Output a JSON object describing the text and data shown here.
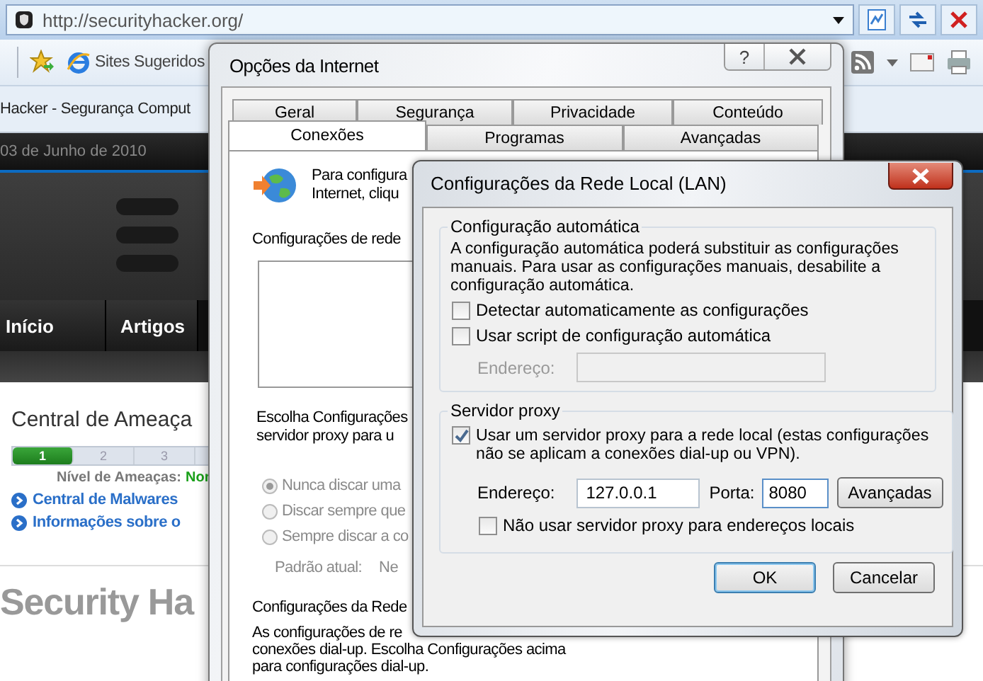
{
  "browser": {
    "address": "http://securityhacker.org/",
    "favorites": [
      {
        "label": "Sites Sugeridos"
      }
    ],
    "tab_title": "Hacker - Segurança Comput",
    "site": {
      "date": "03 de Junho de 2010",
      "nav": [
        {
          "label": "Início"
        },
        {
          "label": "Artigos"
        }
      ],
      "threat_center": {
        "title": "Central de Ameaça",
        "levels": [
          {
            "label": "1",
            "selected": true
          },
          {
            "label": "2",
            "selected": false
          },
          {
            "label": "3",
            "selected": false
          }
        ],
        "level_label": "Nível de Ameaças:",
        "level_value": "Nor"
      },
      "links": [
        "Central de Malwares",
        "Informações sobre o"
      ],
      "heading": "Security Ha"
    }
  },
  "internet_options": {
    "title": "Opções da Internet",
    "help": "?",
    "tab_rows": [
      [
        {
          "label": "Geral",
          "selected": false
        },
        {
          "label": "Segurança",
          "selected": false
        },
        {
          "label": "Privacidade",
          "selected": false
        },
        {
          "label": "Conteúdo",
          "selected": false
        }
      ],
      [
        {
          "label": "Conexões",
          "selected": true
        },
        {
          "label": "Programas",
          "selected": false
        },
        {
          "label": "Avançadas",
          "selected": false
        }
      ]
    ],
    "intro": [
      "Para configura",
      "Internet, cliqu"
    ],
    "network_heading": "Configurações de rede",
    "choose_text": [
      "Escolha Configurações",
      "servidor proxy para u"
    ],
    "dial_disabled": true,
    "dial_options": [
      {
        "label": "Nunca discar uma",
        "selected": true
      },
      {
        "label": "Discar sempre que",
        "selected": false
      },
      {
        "label": "Sempre discar a co",
        "selected": false
      }
    ],
    "current_label": "Padrão atual:",
    "current_value": "Ne",
    "lan_heading": "Configurações da Rede",
    "lan_text": [
      "As configurações de re",
      "conexões dial-up. Escolha Configurações acima",
      "para configurações dial-up."
    ]
  },
  "lan_settings": {
    "title": "Configurações da Rede Local (LAN)",
    "auto": {
      "legend": "Configuração automática",
      "text": "A configuração automática poderá substituir as configurações manuais. Para usar as configurações manuais, desabilite a configuração automática.",
      "options": [
        {
          "label": "Detectar automaticamente as configurações",
          "checked": false
        },
        {
          "label": "Usar script de configuração automática",
          "checked": false
        }
      ],
      "address_label": "Endereço:",
      "address_disabled": true
    },
    "proxy": {
      "legend": "Servidor proxy",
      "use_proxy": {
        "label": "Usar um servidor proxy para a rede local (estas configurações não se aplicam a conexões dial-up ou VPN).",
        "checked": true
      },
      "address_label": "Endereço:",
      "address": "127.0.0.1",
      "port_label": "Porta:",
      "port": "8080",
      "advanced": "Avançadas",
      "bypass": {
        "label": "Não usar servidor proxy para endereços locais",
        "checked": false
      }
    },
    "buttons": [
      "OK",
      "Cancelar"
    ]
  }
}
